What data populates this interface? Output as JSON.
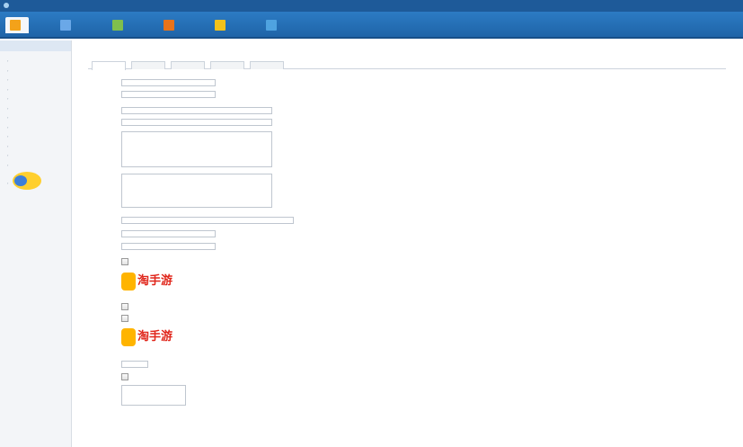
{
  "topbar": {
    "title": "",
    "userbar": ""
  },
  "nav": {
    "items": [
      {
        "label": "",
        "color": "#f3a21a"
      },
      {
        "label": "",
        "color": "#6aa8e8"
      },
      {
        "label": "",
        "color": "#7fbf4d"
      },
      {
        "label": "",
        "color": "#e8731a"
      },
      {
        "label": "",
        "color": "#f3c21a"
      },
      {
        "label": "",
        "color": "#4fa3e0"
      }
    ]
  },
  "sidebar": {
    "heading": "",
    "items": [
      "",
      "",
      "",
      "",
      "",
      "",
      "",
      "",
      "",
      "",
      "",
      ""
    ],
    "last": ""
  },
  "breadcrumb": {
    "prefix": "",
    "current": ""
  },
  "tabs": [
    "",
    "",
    "",
    "",
    ""
  ],
  "form": {
    "name_label": "",
    "name_value": "",
    "url_label": "",
    "url_value": "",
    "url_note": "",
    "title_label": "",
    "title_value": "",
    "keywords_label": "",
    "keywords_value": "",
    "desc_label": "",
    "desc_value": "",
    "copyright_label": "",
    "filter_label": "",
    "filter_value": "",
    "filter_note": "",
    "field1_label": "",
    "icp_label": "",
    "icp_value": "",
    "logo_label": "",
    "choose_file": "",
    "no_file": "",
    "logo_brand": "淘手游",
    "logo_tagline": "",
    "footer_logo_label": "",
    "footer_logo_note": "",
    "mobile_logo_label": "",
    "water_label": "",
    "water_value": "",
    "water_img_label": "",
    "checks_label": "",
    "checks": "",
    "radio_label": "",
    "radio": ""
  }
}
